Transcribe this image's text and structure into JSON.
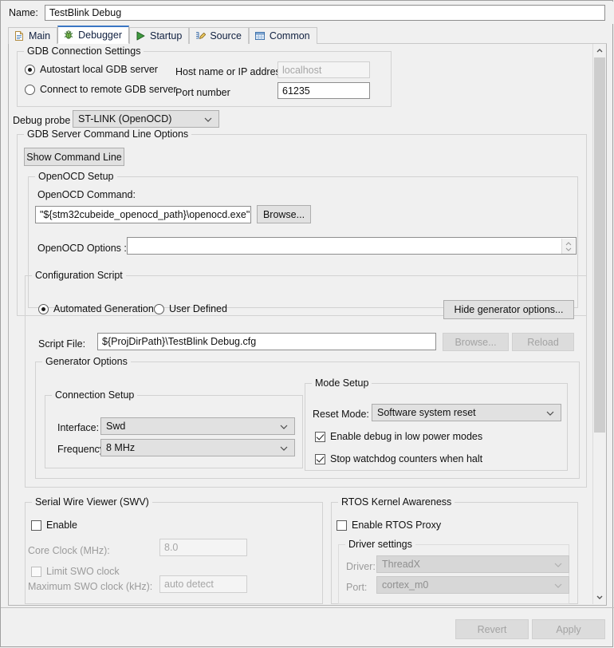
{
  "window": {
    "name_label": "Name:",
    "name_value": "TestBlink Debug"
  },
  "tabs": [
    {
      "label": "Main",
      "icon": "document-icon",
      "selected": false
    },
    {
      "label": "Debugger",
      "icon": "bug-icon",
      "selected": true
    },
    {
      "label": "Startup",
      "icon": "play-icon",
      "selected": false
    },
    {
      "label": "Source",
      "icon": "source-edit-icon",
      "selected": false
    },
    {
      "label": "Common",
      "icon": "table-icon",
      "selected": false
    }
  ],
  "gdb_connection": {
    "title": "GDB Connection Settings",
    "autostart_label": "Autostart local GDB server",
    "autostart_selected": true,
    "remote_label": "Connect to remote GDB server",
    "remote_selected": false,
    "host_label": "Host name or IP address",
    "host_placeholder": "localhost",
    "host_value": "",
    "port_label": "Port number",
    "port_value": "61235"
  },
  "debug_probe": {
    "label": "Debug probe",
    "value": "ST-LINK (OpenOCD)"
  },
  "gdb_server": {
    "title": "GDB Server Command Line Options",
    "show_command_line_button": "Show Command Line",
    "openocd_setup_title": "OpenOCD Setup",
    "openocd_command_label": "OpenOCD Command:",
    "openocd_command_value": "\"${stm32cubeide_openocd_path}\\openocd.exe\"",
    "browse_button": "Browse...",
    "openocd_options_label": "OpenOCD Options :",
    "openocd_options_value": ""
  },
  "configuration_script": {
    "title": "Configuration Script",
    "automated_label": "Automated Generation",
    "automated_selected": true,
    "user_defined_label": "User Defined",
    "user_defined_selected": false,
    "hide_generator_button": "Hide generator options...",
    "script_file_label": "Script File:",
    "script_file_value": "${ProjDirPath}\\TestBlink Debug.cfg",
    "browse_button": "Browse...",
    "reload_button": "Reload"
  },
  "generator_options": {
    "title": "Generator Options",
    "connection_setup": {
      "title": "Connection Setup",
      "interface_label": "Interface:",
      "interface_value": "Swd",
      "frequency_label": "Frequency:",
      "frequency_value": "8 MHz"
    },
    "mode_setup": {
      "title": "Mode Setup",
      "reset_mode_label": "Reset Mode:",
      "reset_mode_value": "Software system reset",
      "low_power_label": "Enable debug in low power modes",
      "low_power_checked": true,
      "watchdog_label": "Stop watchdog counters when halt",
      "watchdog_checked": true
    }
  },
  "swv": {
    "title": "Serial Wire Viewer (SWV)",
    "enable_label": "Enable",
    "enable_checked": false,
    "core_clock_label": "Core Clock (MHz):",
    "core_clock_value": "8.0",
    "limit_swo_label": "Limit SWO clock",
    "limit_swo_checked": false,
    "max_swo_label": "Maximum SWO clock (kHz):",
    "max_swo_value": "auto detect"
  },
  "rtos": {
    "title": "RTOS Kernel Awareness",
    "enable_proxy_label": "Enable RTOS Proxy",
    "enable_proxy_checked": false,
    "driver_settings_title": "Driver settings",
    "driver_label": "Driver:",
    "driver_value": "ThreadX",
    "port_label": "Port:",
    "port_value": "cortex_m0"
  },
  "footer": {
    "revert_button": "Revert",
    "apply_button": "Apply"
  },
  "colors": {
    "accent": "#3a76c4",
    "window_bg": "#f0f0f0",
    "field_bg": "#ffffff",
    "combo_bg": "#e1e1e1"
  }
}
